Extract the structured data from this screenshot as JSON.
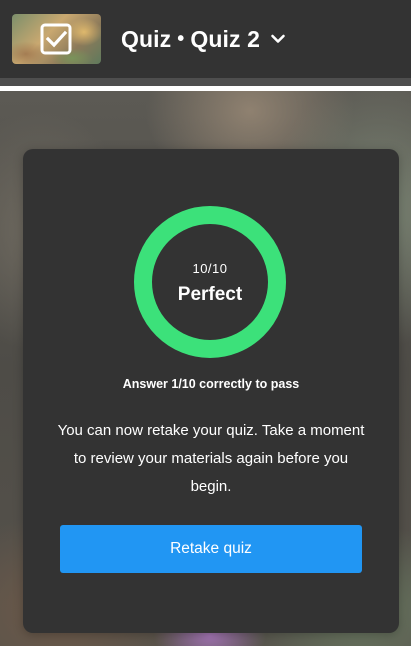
{
  "header": {
    "thumbnail_icon": "check-box-icon",
    "title_part1": "Quiz",
    "title_separator": "•",
    "title_part2": "Quiz 2",
    "dropdown_icon": "chevron-down-icon"
  },
  "result": {
    "score": "10/10",
    "status": "Perfect",
    "progress_fraction": 1.0,
    "ring_color": "#3ce17a",
    "pass_requirement": "Answer 1/10 correctly to pass",
    "message": "You can now retake your quiz. Take a moment to review your materials again before you begin.",
    "retake_button": "Retake quiz",
    "button_color": "#2196f3"
  }
}
